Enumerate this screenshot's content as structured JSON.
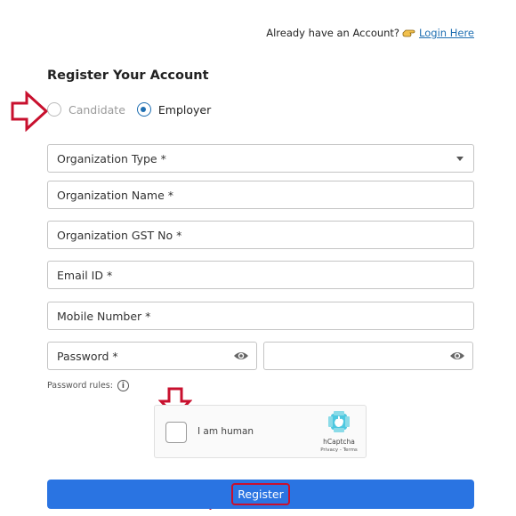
{
  "header": {
    "login_prompt": "Already have an Account?",
    "login_link": "Login Here"
  },
  "form": {
    "title": "Register Your Account",
    "account_type": {
      "options": [
        "Candidate",
        "Employer"
      ],
      "selected": "Employer"
    },
    "fields": {
      "organization_type": "Organization Type *",
      "organization_name": "Organization Name *",
      "organization_gst": "Organization GST No *",
      "email": "Email ID *",
      "mobile": "Mobile Number *",
      "password": "Password *",
      "confirm_password": ""
    },
    "password_rules_label": "Password rules:",
    "info_icon_glyph": "i",
    "captcha": {
      "label": "I am human",
      "brand": "hCaptcha",
      "links": "Privacy - Terms"
    },
    "register_label": "Register"
  },
  "colors": {
    "accent": "#2a74e2",
    "link": "#1f6fb2",
    "annotation_arrow": "#c8102e"
  },
  "icons": {
    "hand": "hand-pointing-icon",
    "eye": "eye-icon",
    "info": "info-icon",
    "dropdown": "chevron-down-icon",
    "captcha_logo": "hcaptcha-logo-icon"
  }
}
